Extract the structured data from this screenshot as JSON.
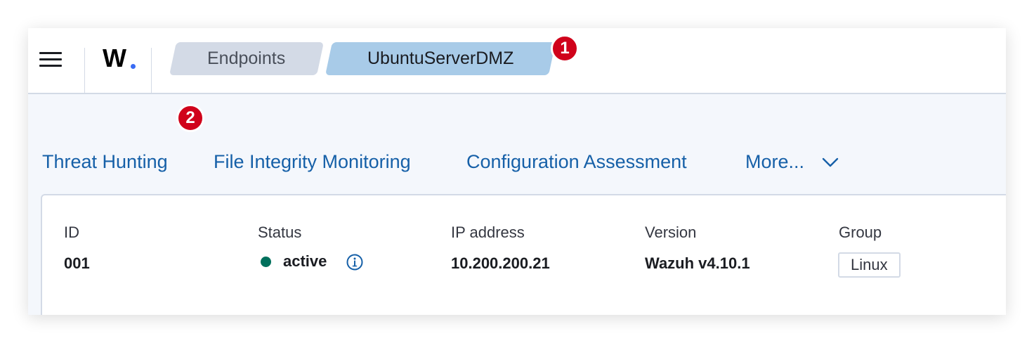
{
  "header": {
    "logo_text": "W",
    "breadcrumbs": [
      {
        "label": "Endpoints"
      },
      {
        "label": "UbuntuServerDMZ"
      }
    ]
  },
  "annotations": {
    "marker_1": "1",
    "marker_2": "2"
  },
  "tabs": [
    {
      "label": "Threat Hunting"
    },
    {
      "label": "File Integrity Monitoring"
    },
    {
      "label": "Configuration Assessment"
    },
    {
      "label": "More..."
    }
  ],
  "agent": {
    "id_label": "ID",
    "id_value": "001",
    "status_label": "Status",
    "status_value": "active",
    "ip_label": "IP address",
    "ip_value": "10.200.200.21",
    "version_label": "Version",
    "version_value": "Wazuh v4.10.1",
    "group_label": "Group",
    "group_value": "Linux"
  },
  "colors": {
    "accent_link": "#1660a8",
    "status_active": "#01705c",
    "marker_red": "#d0021b",
    "breadcrumb_current": "#a8cbe8",
    "breadcrumb_parent": "#d3dae6"
  },
  "icons": [
    "menu-icon",
    "info-icon",
    "chevron-down-icon"
  ]
}
